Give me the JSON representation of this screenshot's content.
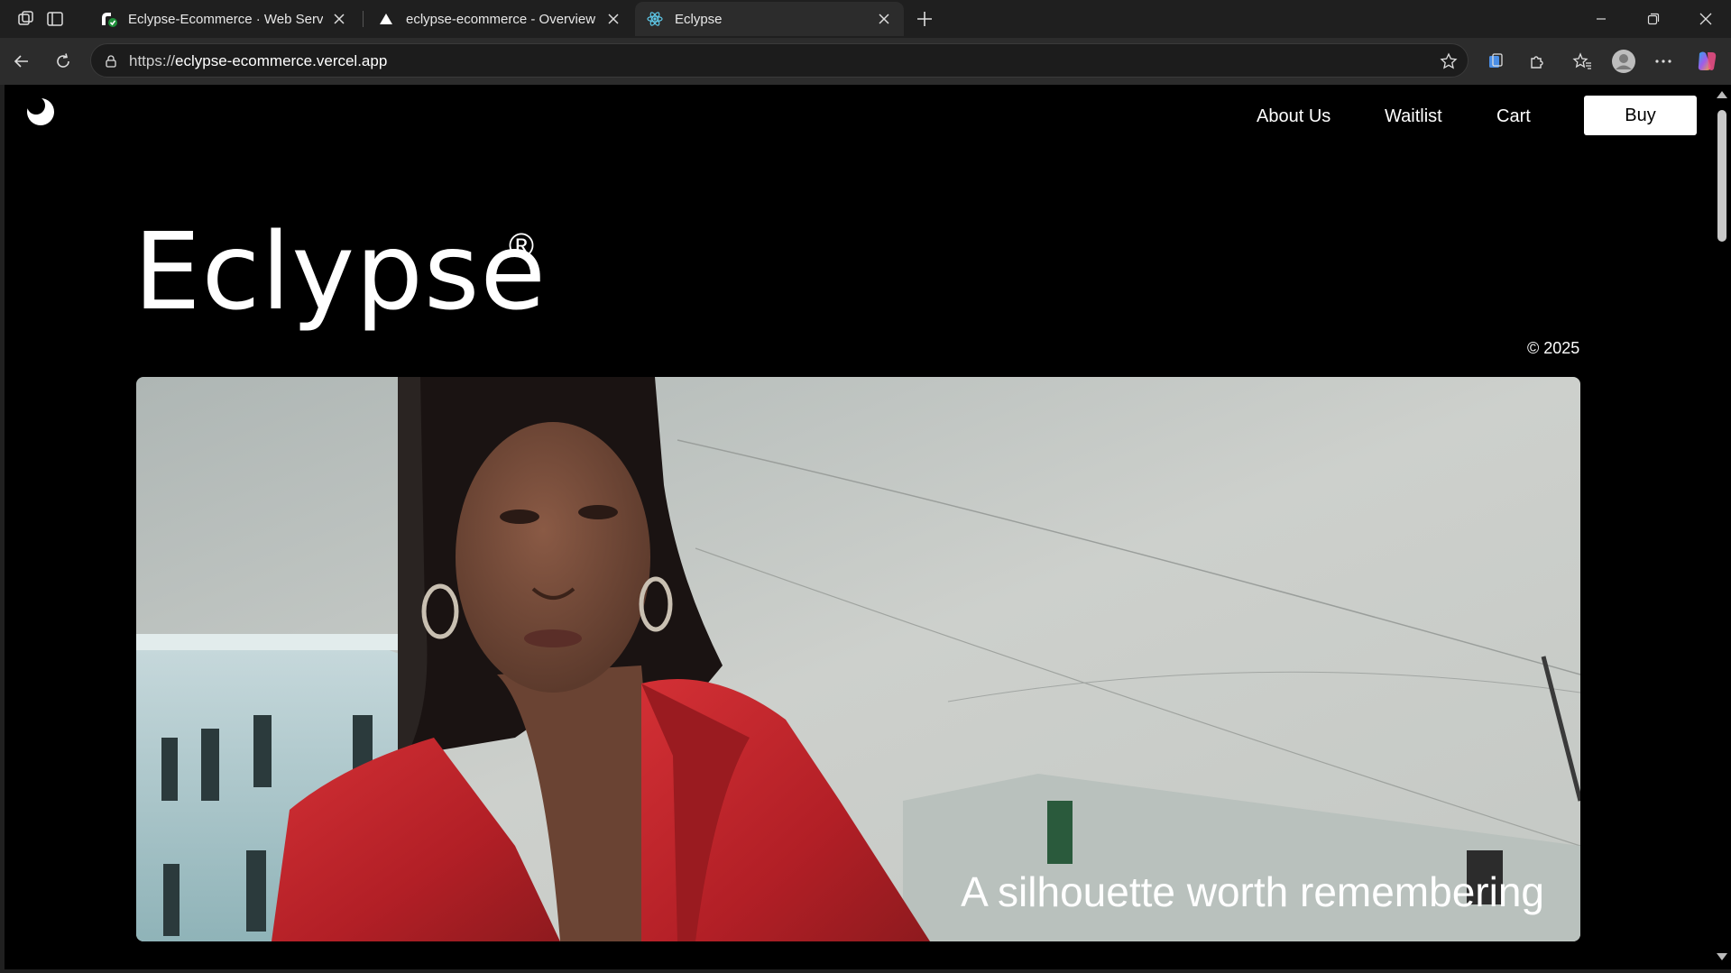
{
  "browser": {
    "tabs": [
      {
        "title": "Eclypse-Ecommerce · Web Servic",
        "favicon": "render-icon",
        "active": false
      },
      {
        "title": "eclypse-ecommerce - Overview –",
        "favicon": "vercel-triangle-icon",
        "active": false
      },
      {
        "title": "Eclypse",
        "favicon": "react-atom-icon",
        "active": true
      }
    ],
    "address": {
      "scheme": "https://",
      "host": "eclypse-ecommerce.vercel.app"
    }
  },
  "site": {
    "nav": {
      "about": "About Us",
      "waitlist": "Waitlist",
      "cart": "Cart",
      "buy": "Buy"
    },
    "hero": {
      "brand": "Eclypse",
      "registered": "®",
      "copyright": "© 2025",
      "caption": "A silhouette worth remembering"
    }
  },
  "colors": {
    "page_bg": "#000000",
    "chrome_bg": "#1f1f1f",
    "toolbar_bg": "#2c2c2c",
    "jacket_red": "#c0252b",
    "sky": "#c9ccc9"
  }
}
